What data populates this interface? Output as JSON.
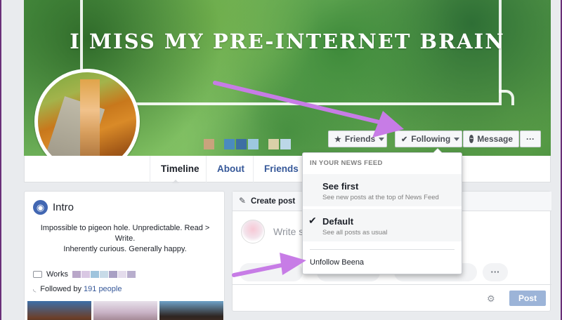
{
  "cover": {
    "title": "I MISS MY PRE-INTERNET BRAIN"
  },
  "actions": {
    "friends": "Friends",
    "following": "Following",
    "message": "Message",
    "more": "···"
  },
  "nav": {
    "tabs": [
      "Timeline",
      "About",
      "Friends"
    ]
  },
  "intro": {
    "title": "Intro",
    "bio_line1": "Impossible to pigeon hole. Unpredictable. Read >",
    "bio_line2": "Write.",
    "bio_line3": "Inherently curious. Generally happy.",
    "works_label": "Works",
    "followed_prefix": "Followed by ",
    "followed_count": "191 people"
  },
  "create_post": {
    "label": "Create post",
    "placeholder": "Write so",
    "post_button": "Post"
  },
  "dropdown": {
    "section": "IN YOUR NEWS FEED",
    "options": [
      {
        "title": "See first",
        "desc": "See new posts at the top of News Feed",
        "checked": false
      },
      {
        "title": "Default",
        "desc": "See all posts as usual",
        "checked": true
      }
    ],
    "unfollow": "Unfollow Beena"
  },
  "colors": {
    "annotation_arrow": "#c77ce6",
    "post_button": "#9cb4d8",
    "link_blue": "#365899"
  }
}
